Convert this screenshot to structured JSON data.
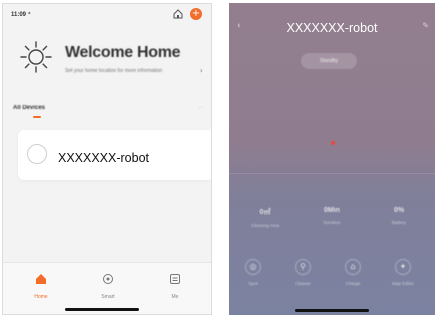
{
  "left_screen": {
    "status": {
      "time": "11:09 ⁺"
    },
    "header": {
      "add_symbol": "+"
    },
    "welcome": {
      "title": "Welcome Home",
      "subtitle": "Set your home location for more information"
    },
    "devices_section": {
      "title": "All Devices",
      "more": "···"
    },
    "device_card": {
      "name": "XXXXXXX-robot"
    },
    "tabbar": {
      "tabs": [
        {
          "label": "Home",
          "icon": "home-icon",
          "active": true
        },
        {
          "label": "Smart",
          "icon": "smart-icon",
          "active": false
        },
        {
          "label": "Me",
          "icon": "me-icon",
          "active": false
        }
      ]
    }
  },
  "right_screen": {
    "title": "XXXXXXX-robot",
    "mode": "Standby",
    "stats": [
      {
        "value": "0㎡",
        "label": "Cleaning Area"
      },
      {
        "value": "0Min",
        "label": "Duration"
      },
      {
        "value": "0%",
        "label": "Battery"
      }
    ],
    "controls": [
      {
        "label": "Spot",
        "icon": "spot-icon"
      },
      {
        "label": "Cleaner",
        "icon": "clean-icon"
      },
      {
        "label": "Charge",
        "icon": "charge-icon"
      },
      {
        "label": "Map Editor",
        "icon": "map-edit-icon"
      }
    ]
  },
  "colors": {
    "accent": "#f36d2a",
    "right_top": "#927e8f",
    "right_bottom": "#7b82a1",
    "map_dot": "#e64b3c"
  }
}
